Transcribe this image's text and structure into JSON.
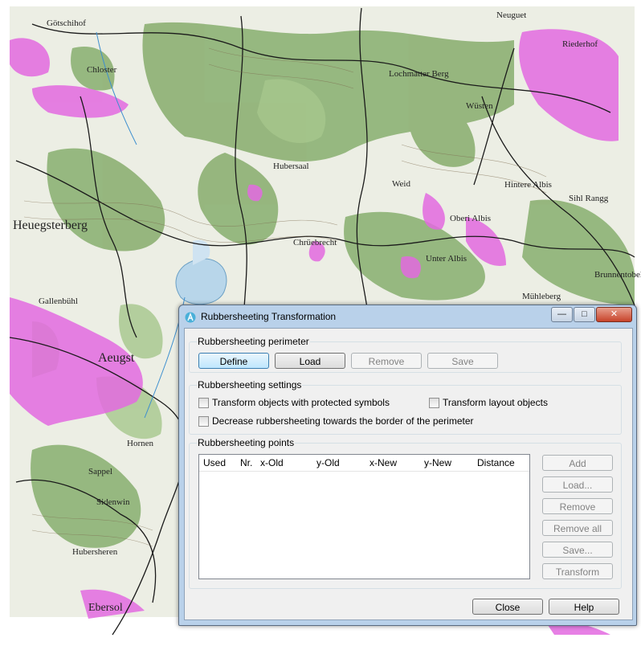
{
  "dialog": {
    "title": "Rubbersheeting Transformation",
    "window_buttons": {
      "minimize": "—",
      "maximize": "□",
      "close": "✕"
    },
    "perimeter": {
      "title": "Rubbersheeting perimeter",
      "define": "Define",
      "load": "Load",
      "remove": "Remove",
      "save": "Save"
    },
    "settings": {
      "title": "Rubbersheeting settings",
      "protected_symbols": "Transform objects with protected symbols",
      "layout_objects": "Transform layout objects",
      "decrease_border": "Decrease rubbersheeting towards the border of the perimeter"
    },
    "points": {
      "title": "Rubbersheeting points",
      "columns": [
        "Used",
        "Nr.",
        "x-Old",
        "y-Old",
        "x-New",
        "y-New",
        "Distance"
      ],
      "buttons": {
        "add": "Add",
        "load": "Load...",
        "remove": "Remove",
        "remove_all": "Remove all",
        "save": "Save...",
        "transform": "Transform"
      }
    },
    "close": "Close",
    "help": "Help"
  },
  "map": {
    "labels": {
      "l1": "Götschihof",
      "l2": "Chloster",
      "l3": "Neuguet",
      "l4": "Riederhof",
      "l5": "Lochmatter Berg",
      "l6": "Wüsten",
      "l7": "Oberi Albis",
      "l8": "Sihl Rangg",
      "l9": "Hubersaal",
      "l10": "Chrüebrecht",
      "l11": "Weid",
      "l12": "Hintere Albis",
      "l13": "Unter Albis",
      "l14": "Heuegsterberg",
      "l15": "Aeugst",
      "l16": "Gallenbühl",
      "l17": "Hornen",
      "l18": "Sidenwin",
      "l19": "Hubersheren",
      "l20": "Ebersol",
      "l21": "Brunnentobel",
      "l22": "Mühleberg",
      "l23": "Sappel"
    },
    "colors": {
      "forest": "#8ab073",
      "meadow": "#e9ece0",
      "urban": "#e36ae0",
      "lake": "#b8d6ea"
    }
  }
}
